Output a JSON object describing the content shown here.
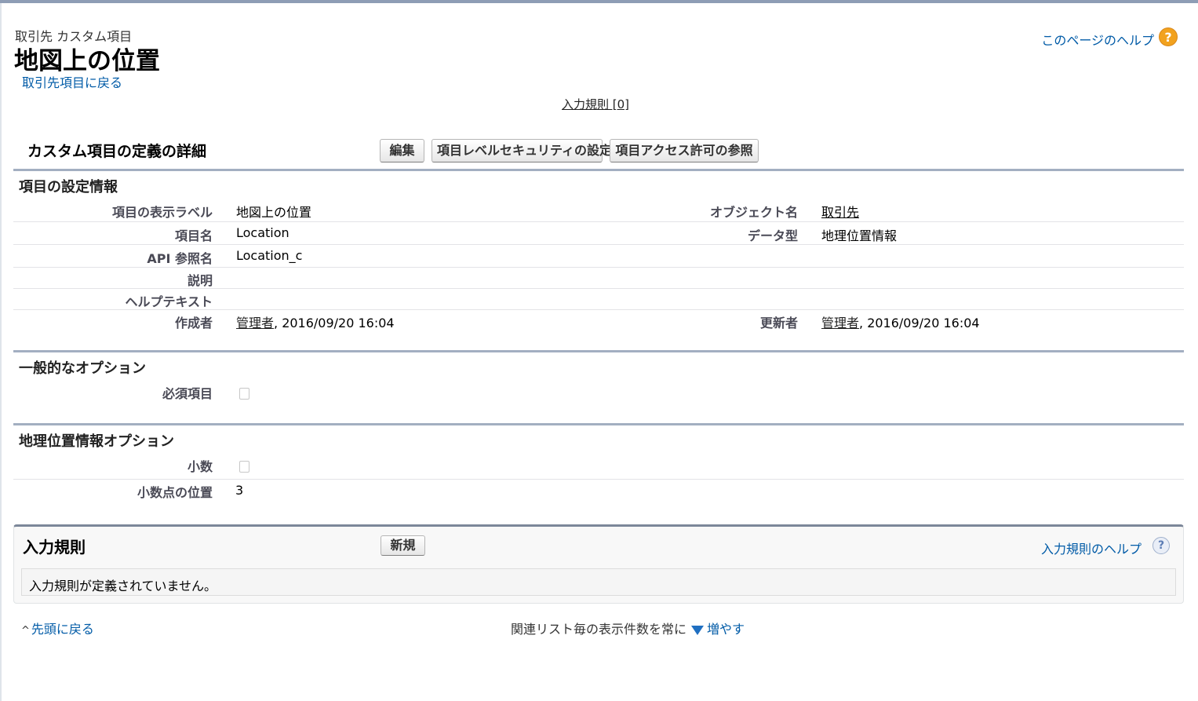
{
  "header": {
    "object_type": "取引先 カスタム項目",
    "title": "地図上の位置",
    "back_link": "取引先項目に戻る",
    "help_link": "このページのヘルプ",
    "help_icon_glyph": "?",
    "validation_rules_link": "入力規則 [0]"
  },
  "detail": {
    "section_title": "カスタム項目の定義の詳細",
    "buttons": {
      "edit": "編集",
      "field_security": "項目レベルセキュリティの設定",
      "view_access": "項目アクセス許可の参照"
    }
  },
  "field_info": {
    "title": "項目の設定情報",
    "label_label": "項目の表示ラベル",
    "label_value": "地図上の位置",
    "object_label": "オブジェクト名",
    "object_value": "取引先",
    "field_name_label": "項目名",
    "field_name_value": "Location",
    "data_type_label": "データ型",
    "data_type_value": "地理位置情報",
    "api_name_label": "API 参照名",
    "api_name_value": "Location_c",
    "description_label": "説明",
    "help_text_label": "ヘルプテキスト",
    "created_by_label": "作成者",
    "created_by_user": "管理者",
    "created_by_date": ", 2016/09/20 16:04",
    "modified_by_label": "更新者",
    "modified_by_user": "管理者",
    "modified_by_date": ", 2016/09/20 16:04"
  },
  "general_options": {
    "title": "一般的なオプション",
    "required_label": "必須項目",
    "required_checked": false
  },
  "geo_options": {
    "title": "地理位置情報オプション",
    "decimal_label": "小数",
    "decimal_checked": false,
    "decimal_places_label": "小数点の位置",
    "decimal_places_value": "3"
  },
  "validation_rules": {
    "title": "入力規則",
    "new_button": "新規",
    "help_link": "入力規則のヘルプ",
    "help_icon_glyph": "?",
    "empty_message": "入力規則が定義されていません。"
  },
  "footer": {
    "back_to_top": "先頭に戻る",
    "chevron_glyph": "^",
    "related_list_text": "関連リスト毎の表示件数を常に",
    "increase_link": "増やす"
  },
  "colors": {
    "link": "#015ba7",
    "section_rule": "#a3afc1",
    "help_icon": "#f2a21e"
  }
}
